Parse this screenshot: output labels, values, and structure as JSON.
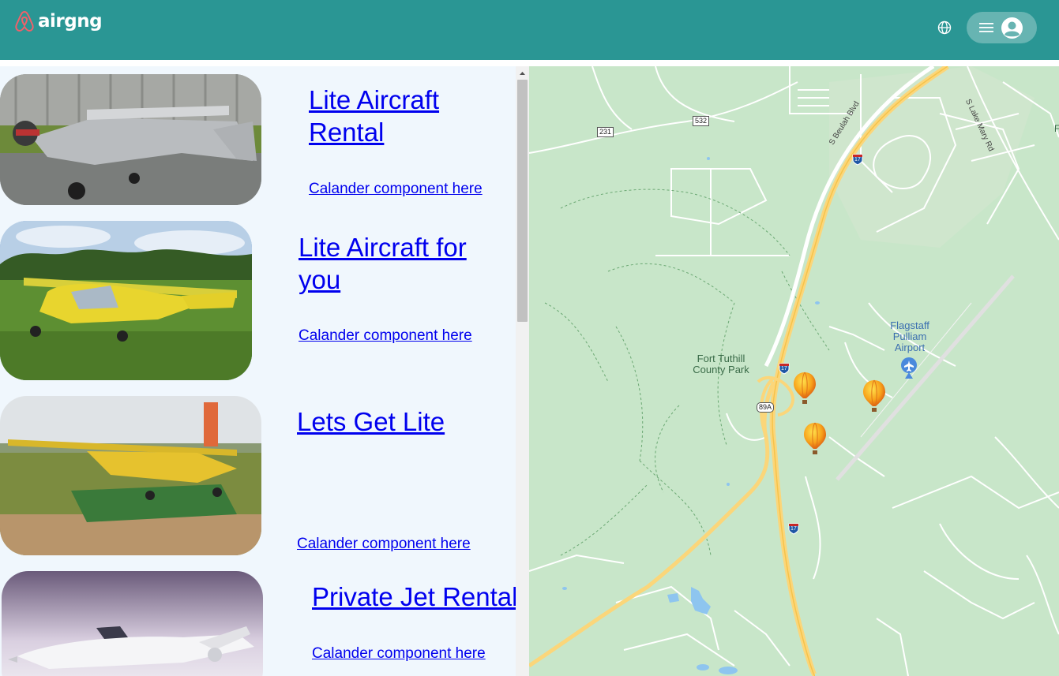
{
  "header": {
    "brand": "airgng",
    "brand_color": "#2a9694",
    "logo_icon": "airbnb-logo-icon",
    "globe_icon": "globe-icon",
    "menu_icon": "hamburger-menu-icon",
    "avatar_icon": "user-avatar-icon"
  },
  "listings": [
    {
      "title": "Lite Aircraft Rental",
      "calendar": "Calander component here",
      "image": "silver-light-aircraft-photo"
    },
    {
      "title": "Lite Aircraft for you",
      "calendar": "Calander component here",
      "image": "yellow-ultralight-aircraft-photo"
    },
    {
      "title": "Lets Get Lite",
      "calendar": "Calander component here",
      "image": "yellow-high-wing-aircraft-photo"
    },
    {
      "title": "Private Jet Rental",
      "calendar": "Calander component here",
      "image": "white-private-jet-photo"
    }
  ],
  "map": {
    "places": {
      "park": "Fort Tuthill County Park",
      "airport": "Flagstaff Pulliam Airport"
    },
    "roads": {
      "beulah": "S Beulah Blvd",
      "lake_mary": "S Lake Mary Rd",
      "r231": "231",
      "r532": "532",
      "i17": "17",
      "r89a": "89A",
      "partial": "F"
    },
    "markers": [
      "hot-air-balloon-marker",
      "hot-air-balloon-marker",
      "hot-air-balloon-marker"
    ]
  }
}
